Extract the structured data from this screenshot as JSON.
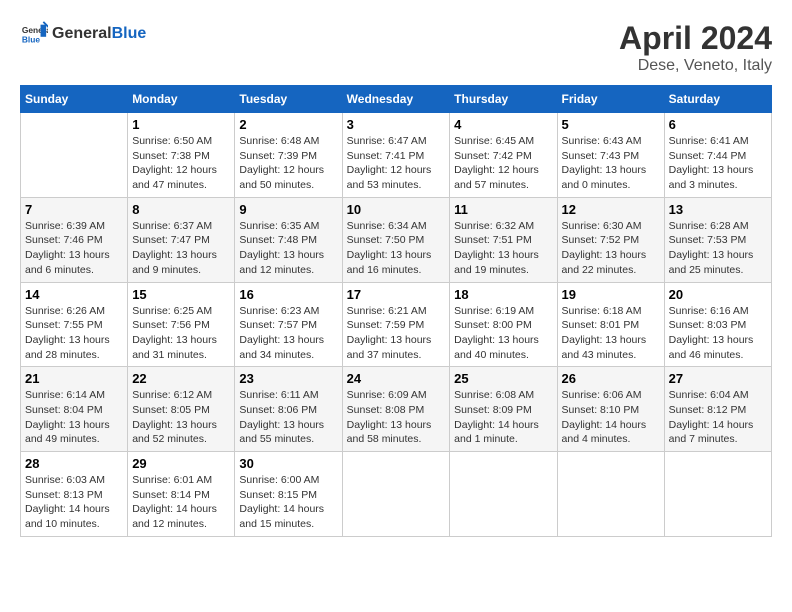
{
  "header": {
    "logo_general": "General",
    "logo_blue": "Blue",
    "title": "April 2024",
    "subtitle": "Dese, Veneto, Italy"
  },
  "calendar": {
    "weekdays": [
      "Sunday",
      "Monday",
      "Tuesday",
      "Wednesday",
      "Thursday",
      "Friday",
      "Saturday"
    ],
    "weeks": [
      [
        {
          "day": "",
          "info": ""
        },
        {
          "day": "1",
          "info": "Sunrise: 6:50 AM\nSunset: 7:38 PM\nDaylight: 12 hours\nand 47 minutes."
        },
        {
          "day": "2",
          "info": "Sunrise: 6:48 AM\nSunset: 7:39 PM\nDaylight: 12 hours\nand 50 minutes."
        },
        {
          "day": "3",
          "info": "Sunrise: 6:47 AM\nSunset: 7:41 PM\nDaylight: 12 hours\nand 53 minutes."
        },
        {
          "day": "4",
          "info": "Sunrise: 6:45 AM\nSunset: 7:42 PM\nDaylight: 12 hours\nand 57 minutes."
        },
        {
          "day": "5",
          "info": "Sunrise: 6:43 AM\nSunset: 7:43 PM\nDaylight: 13 hours\nand 0 minutes."
        },
        {
          "day": "6",
          "info": "Sunrise: 6:41 AM\nSunset: 7:44 PM\nDaylight: 13 hours\nand 3 minutes."
        }
      ],
      [
        {
          "day": "7",
          "info": "Sunrise: 6:39 AM\nSunset: 7:46 PM\nDaylight: 13 hours\nand 6 minutes."
        },
        {
          "day": "8",
          "info": "Sunrise: 6:37 AM\nSunset: 7:47 PM\nDaylight: 13 hours\nand 9 minutes."
        },
        {
          "day": "9",
          "info": "Sunrise: 6:35 AM\nSunset: 7:48 PM\nDaylight: 13 hours\nand 12 minutes."
        },
        {
          "day": "10",
          "info": "Sunrise: 6:34 AM\nSunset: 7:50 PM\nDaylight: 13 hours\nand 16 minutes."
        },
        {
          "day": "11",
          "info": "Sunrise: 6:32 AM\nSunset: 7:51 PM\nDaylight: 13 hours\nand 19 minutes."
        },
        {
          "day": "12",
          "info": "Sunrise: 6:30 AM\nSunset: 7:52 PM\nDaylight: 13 hours\nand 22 minutes."
        },
        {
          "day": "13",
          "info": "Sunrise: 6:28 AM\nSunset: 7:53 PM\nDaylight: 13 hours\nand 25 minutes."
        }
      ],
      [
        {
          "day": "14",
          "info": "Sunrise: 6:26 AM\nSunset: 7:55 PM\nDaylight: 13 hours\nand 28 minutes."
        },
        {
          "day": "15",
          "info": "Sunrise: 6:25 AM\nSunset: 7:56 PM\nDaylight: 13 hours\nand 31 minutes."
        },
        {
          "day": "16",
          "info": "Sunrise: 6:23 AM\nSunset: 7:57 PM\nDaylight: 13 hours\nand 34 minutes."
        },
        {
          "day": "17",
          "info": "Sunrise: 6:21 AM\nSunset: 7:59 PM\nDaylight: 13 hours\nand 37 minutes."
        },
        {
          "day": "18",
          "info": "Sunrise: 6:19 AM\nSunset: 8:00 PM\nDaylight: 13 hours\nand 40 minutes."
        },
        {
          "day": "19",
          "info": "Sunrise: 6:18 AM\nSunset: 8:01 PM\nDaylight: 13 hours\nand 43 minutes."
        },
        {
          "day": "20",
          "info": "Sunrise: 6:16 AM\nSunset: 8:03 PM\nDaylight: 13 hours\nand 46 minutes."
        }
      ],
      [
        {
          "day": "21",
          "info": "Sunrise: 6:14 AM\nSunset: 8:04 PM\nDaylight: 13 hours\nand 49 minutes."
        },
        {
          "day": "22",
          "info": "Sunrise: 6:12 AM\nSunset: 8:05 PM\nDaylight: 13 hours\nand 52 minutes."
        },
        {
          "day": "23",
          "info": "Sunrise: 6:11 AM\nSunset: 8:06 PM\nDaylight: 13 hours\nand 55 minutes."
        },
        {
          "day": "24",
          "info": "Sunrise: 6:09 AM\nSunset: 8:08 PM\nDaylight: 13 hours\nand 58 minutes."
        },
        {
          "day": "25",
          "info": "Sunrise: 6:08 AM\nSunset: 8:09 PM\nDaylight: 14 hours\nand 1 minute."
        },
        {
          "day": "26",
          "info": "Sunrise: 6:06 AM\nSunset: 8:10 PM\nDaylight: 14 hours\nand 4 minutes."
        },
        {
          "day": "27",
          "info": "Sunrise: 6:04 AM\nSunset: 8:12 PM\nDaylight: 14 hours\nand 7 minutes."
        }
      ],
      [
        {
          "day": "28",
          "info": "Sunrise: 6:03 AM\nSunset: 8:13 PM\nDaylight: 14 hours\nand 10 minutes."
        },
        {
          "day": "29",
          "info": "Sunrise: 6:01 AM\nSunset: 8:14 PM\nDaylight: 14 hours\nand 12 minutes."
        },
        {
          "day": "30",
          "info": "Sunrise: 6:00 AM\nSunset: 8:15 PM\nDaylight: 14 hours\nand 15 minutes."
        },
        {
          "day": "",
          "info": ""
        },
        {
          "day": "",
          "info": ""
        },
        {
          "day": "",
          "info": ""
        },
        {
          "day": "",
          "info": ""
        }
      ]
    ]
  }
}
